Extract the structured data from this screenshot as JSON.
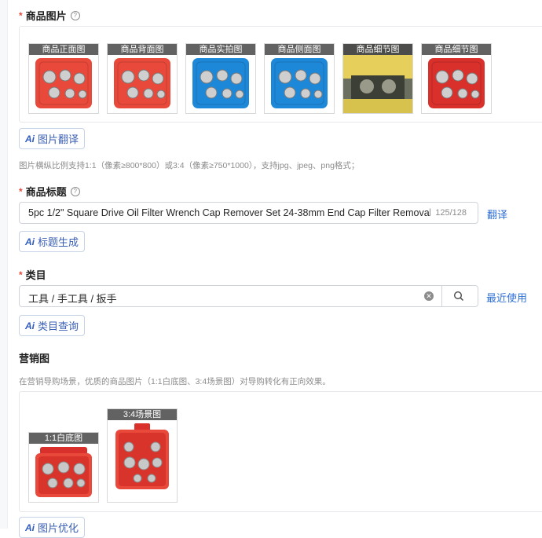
{
  "product_images": {
    "label": "商品图片",
    "help_icon": "question-circle-icon",
    "thumbs": [
      {
        "label": "商品正面图",
        "case_color": "#e8493a"
      },
      {
        "label": "商品背面图",
        "case_color": "#e8493a"
      },
      {
        "label": "商品实拍图",
        "case_color": "#1e88d8"
      },
      {
        "label": "商品侧面图",
        "case_color": "#1e88d8"
      },
      {
        "label": "商品细节图",
        "case_color": "#c9a23a"
      },
      {
        "label": "商品细节图",
        "case_color": "#d9302b"
      }
    ],
    "translate_button": "图片翻译",
    "hint": "图片横纵比例支持1:1（像素≥800*800）或3:4（像素≥750*1000），支持jpg、jpeg、png格式；"
  },
  "title_field": {
    "label": "商品标题",
    "value": "5pc 1/2\" Square Drive Oil Filter Wrench Cap Remover Set 24-38mm End Cap Filter Removal",
    "count": "125/128",
    "translate_link": "翻译",
    "generate_button": "标题生成"
  },
  "category_field": {
    "label": "类目",
    "value": "工具 / 手工具 / 扳手",
    "recent_link": "最近使用",
    "query_button": "类目查询"
  },
  "marketing": {
    "label": "营销图",
    "hint": "在营销导购场景，优质的商品图片（1:1白底图、3:4场景图）对导购转化有正向效果。",
    "thumbs": [
      {
        "label": "1:1白底图"
      },
      {
        "label": "3:4场景图"
      }
    ],
    "optimize_button": "图片优化"
  },
  "colors": {
    "accent": "#2f6fd6",
    "required": "#e8493a"
  },
  "ai_icon_text": "Ai"
}
